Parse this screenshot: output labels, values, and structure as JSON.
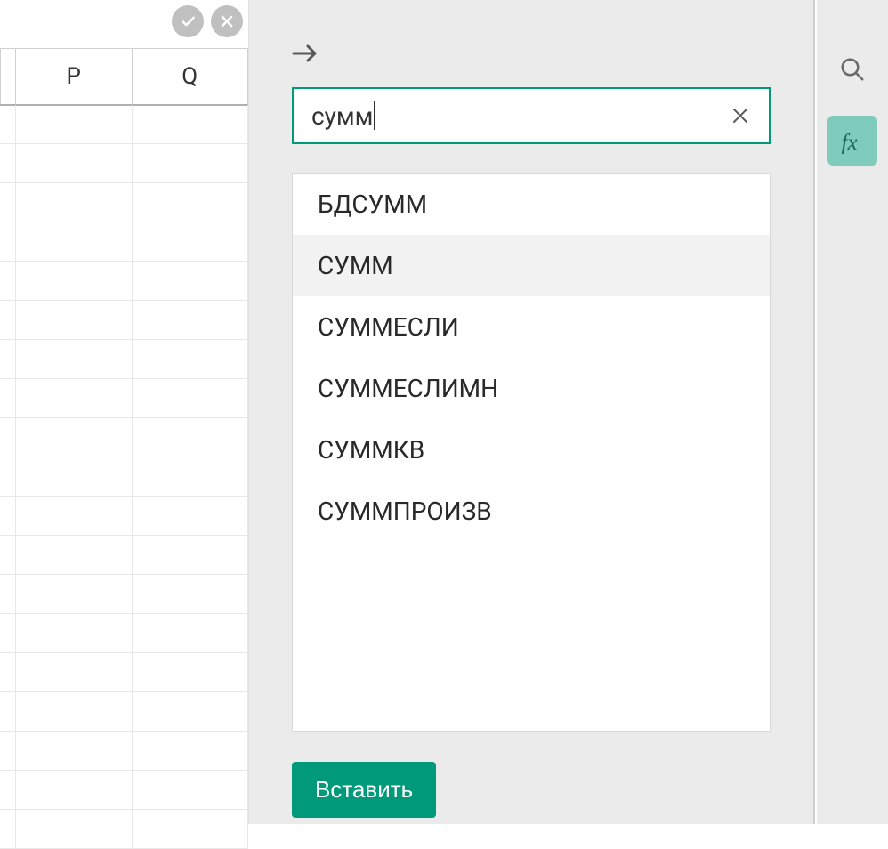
{
  "columns": [
    "P",
    "Q"
  ],
  "search": {
    "value": "сумм",
    "placeholder": ""
  },
  "results": [
    {
      "label": "БДСУММ",
      "selected": false
    },
    {
      "label": "СУММ",
      "selected": true
    },
    {
      "label": "СУММЕСЛИ",
      "selected": false
    },
    {
      "label": "СУММЕСЛИМН",
      "selected": false
    },
    {
      "label": "СУММКВ",
      "selected": false
    },
    {
      "label": "СУММПРОИЗВ",
      "selected": false
    }
  ],
  "insert_label": "Вставить",
  "row_count": 19
}
